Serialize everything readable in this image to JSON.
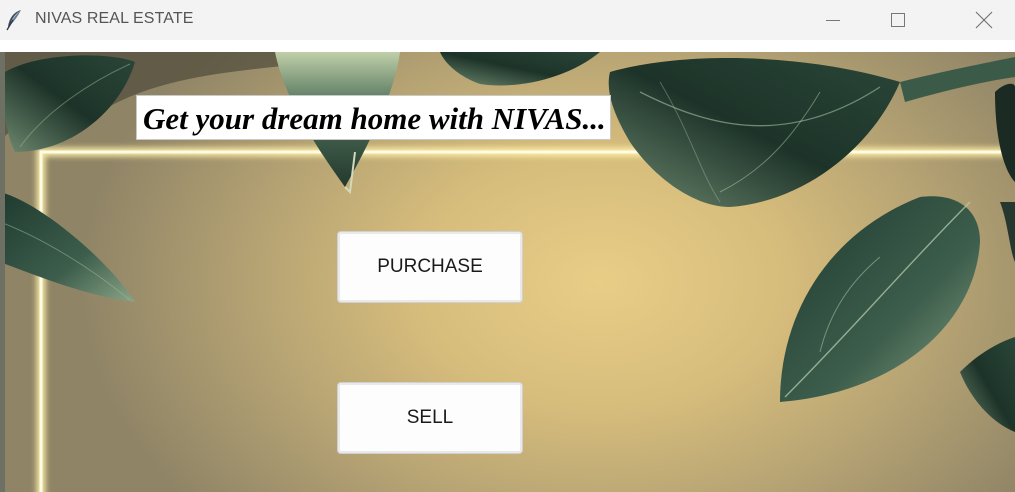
{
  "window": {
    "title": "NIVAS REAL ESTATE",
    "app_icon": "feather-icon",
    "controls": {
      "minimize_icon": "minimize-icon",
      "maximize_icon": "maximize-icon",
      "close_icon": "close-icon"
    }
  },
  "main": {
    "headline": "Get your dream home with NIVAS...",
    "buttons": {
      "purchase_label": "PURCHASE",
      "sell_label": "SELL"
    }
  },
  "colors": {
    "titlebar_bg": "#f3f3f3",
    "background_gold": "#e8cd87",
    "leaf_green": "#2f4a3c",
    "frame_glow": "#fff4b8"
  }
}
